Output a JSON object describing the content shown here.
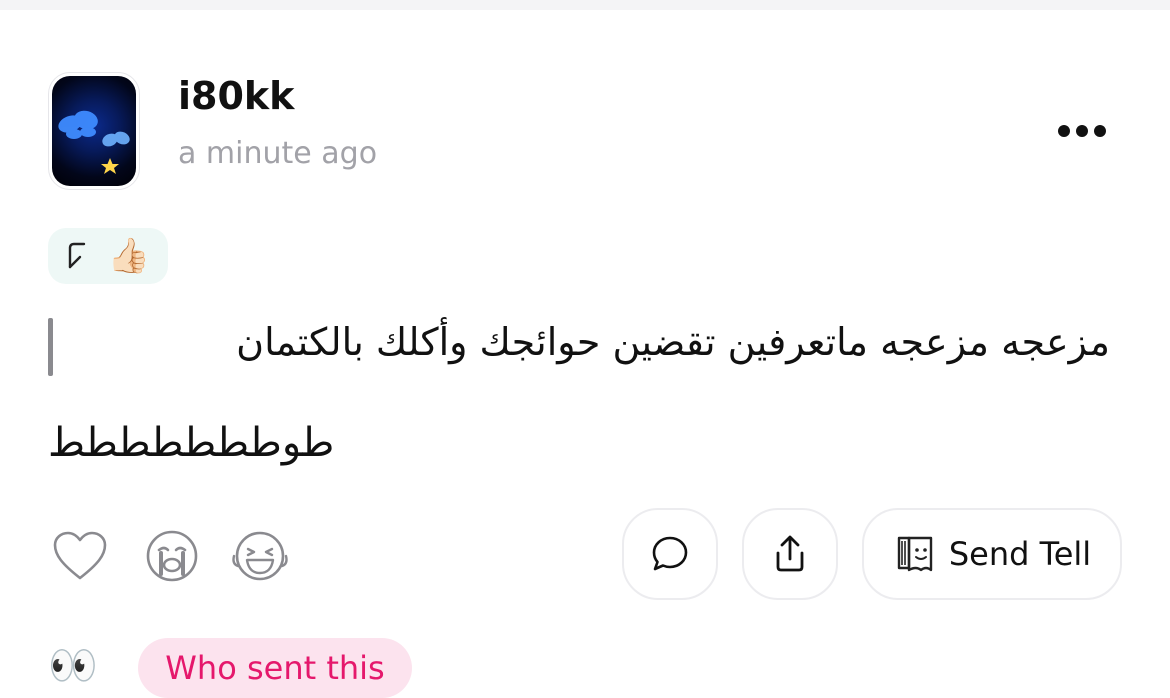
{
  "post": {
    "username": "i80kk",
    "timestamp": "a minute ago",
    "reply_reaction": "👍🏻",
    "quoted_text": "مزعجه مزعجه ماتعرفين تقضين حوائجك وأكلك بالكتمان",
    "body_text": "طوططططططط"
  },
  "actions": {
    "send_tell_label": "Send Tell"
  },
  "footer": {
    "eyes_emoji": "👀",
    "who_sent_label": "Who sent this"
  },
  "colors": {
    "badge_text": "#e5186c",
    "badge_bg": "#fce3ee",
    "reply_chip_bg": "#eef8f6",
    "timestamp": "#a2a2a8"
  },
  "icons": [
    "avatar-butterfly",
    "more-dots-icon",
    "reply-arrow-icon",
    "heart-icon",
    "crying-face-icon",
    "laughing-face-icon",
    "comment-bubble-icon",
    "share-icon",
    "tell-book-icon"
  ]
}
